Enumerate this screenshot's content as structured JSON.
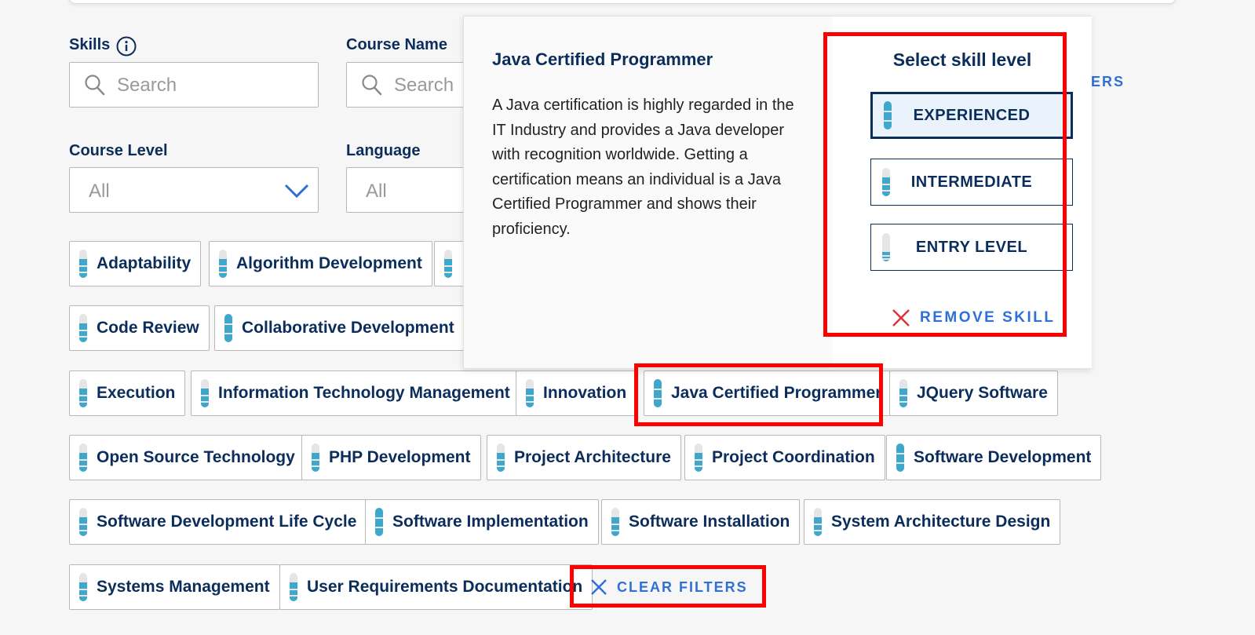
{
  "filters": {
    "skills_label": "Skills",
    "skills_placeholder": "Search",
    "course_name_label": "Course Name",
    "course_name_placeholder": "Search",
    "course_level_label": "Course Level",
    "course_level_value": "All",
    "language_label": "Language",
    "language_value": "All",
    "partial_clear_text": "ERS"
  },
  "chips": [
    {
      "label": "Adaptability",
      "level": 0.66
    },
    {
      "label": "Algorithm Development",
      "level": 0.66
    },
    {
      "label": "",
      "level": 0.66
    },
    {
      "label": "Code Review",
      "level": 0.66
    },
    {
      "label": "Collaborative Development",
      "level": 1.0
    },
    {
      "label": "Execution",
      "level": 0.66
    },
    {
      "label": "Information Technology Management",
      "level": 0.66
    },
    {
      "label": "Innovation",
      "level": 0.66
    },
    {
      "label": "Java Certified Programmer",
      "level": 1.0
    },
    {
      "label": "JQuery Software",
      "level": 0.66
    },
    {
      "label": "Open Source Technology",
      "level": 0.66
    },
    {
      "label": "PHP Development",
      "level": 0.66
    },
    {
      "label": "Project Architecture",
      "level": 0.66
    },
    {
      "label": "Project Coordination",
      "level": 0.66
    },
    {
      "label": "Software Development",
      "level": 1.0
    },
    {
      "label": "Software Development Life Cycle",
      "level": 0.66
    },
    {
      "label": "Software Implementation",
      "level": 1.0
    },
    {
      "label": "Software Installation",
      "level": 0.66
    },
    {
      "label": "System Architecture Design",
      "level": 0.66
    },
    {
      "label": "Systems Management",
      "level": 0.66
    },
    {
      "label": "User Requirements Documentation",
      "level": 0.66
    }
  ],
  "clear_filters_label": "CLEAR FILTERS",
  "popover": {
    "title": "Java Certified Programmer",
    "description": "A Java certification is highly regarded in the IT Industry and provides a Java developer with recognition worldwide. Getting a certification means an individual is a Java Certified Programmer and shows their proficiency.",
    "select_title": "Select skill level",
    "levels": [
      {
        "label": "EXPERIENCED",
        "level": 1.0,
        "selected": true
      },
      {
        "label": "INTERMEDIATE",
        "level": 0.66,
        "selected": false
      },
      {
        "label": "ENTRY LEVEL",
        "level": 0.33,
        "selected": false
      }
    ],
    "remove_label": "REMOVE SKILL"
  },
  "colors": {
    "accent_blue": "#2f6fd6",
    "navy": "#0b2d5c",
    "level_fill": "#3fa7cc",
    "highlight_red": "#ff0000"
  }
}
